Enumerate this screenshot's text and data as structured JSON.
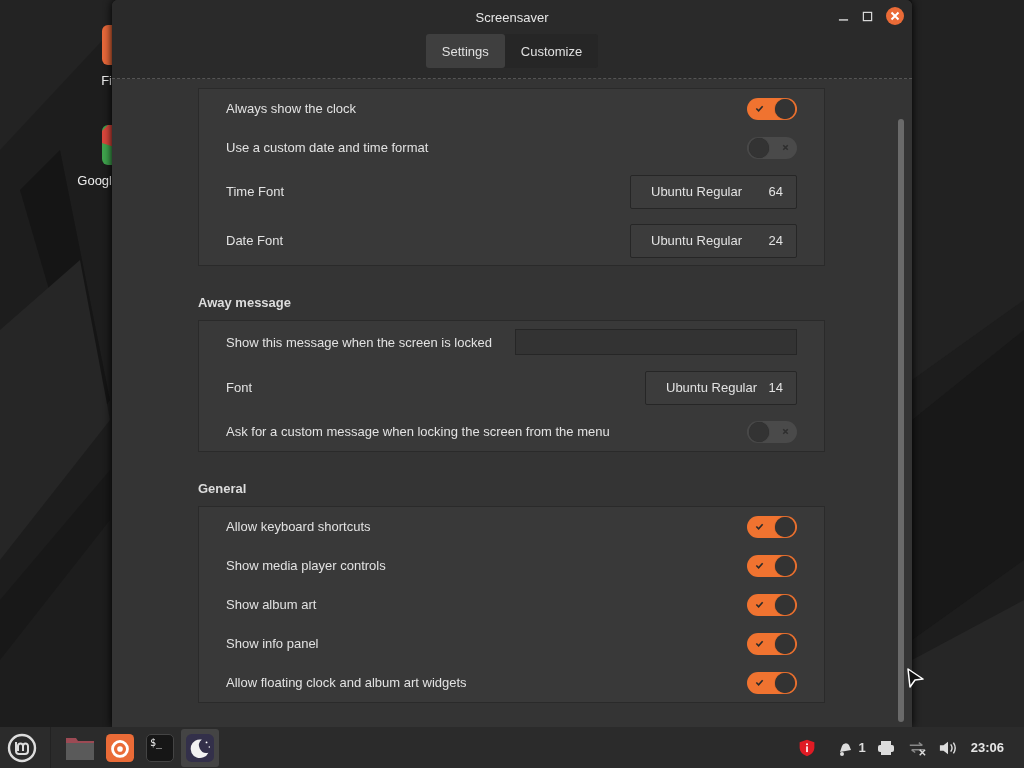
{
  "desktop_icons": [
    {
      "label": "Fi"
    },
    {
      "label": "Googl"
    }
  ],
  "window": {
    "title": "Screensaver",
    "tabs": [
      {
        "label": "Settings",
        "selected": true
      },
      {
        "label": "Customize",
        "selected": false
      }
    ],
    "sections": [
      {
        "rows": [
          {
            "kind": "toggle",
            "label": "Always show the clock",
            "on": true
          },
          {
            "kind": "toggle",
            "label": "Use a custom date and time format",
            "on": false
          },
          {
            "kind": "font",
            "label": "Time Font",
            "font": "Ubuntu Regular",
            "size": "64"
          },
          {
            "kind": "font",
            "label": "Date Font",
            "font": "Ubuntu Regular",
            "size": "24"
          }
        ]
      },
      {
        "heading": "Away message",
        "rows": [
          {
            "kind": "entry",
            "label": "Show this message when the screen is locked"
          },
          {
            "kind": "font",
            "label": "Font",
            "font": "Ubuntu Regular",
            "size": "14"
          },
          {
            "kind": "toggle",
            "label": "Ask for a custom message when locking the screen from the menu",
            "on": false
          }
        ]
      },
      {
        "heading": "General",
        "rows": [
          {
            "kind": "toggle",
            "label": "Allow keyboard shortcuts",
            "on": true
          },
          {
            "kind": "toggle",
            "label": "Show media player controls",
            "on": true
          },
          {
            "kind": "toggle",
            "label": "Show album art",
            "on": true
          },
          {
            "kind": "toggle",
            "label": "Show info panel",
            "on": true
          },
          {
            "kind": "toggle",
            "label": "Allow floating clock and album art widgets",
            "on": true
          }
        ]
      }
    ]
  },
  "taskbar": {
    "launchers": [
      {
        "kind": "folder",
        "selected": false
      },
      {
        "kind": "browser",
        "selected": false
      },
      {
        "kind": "terminal",
        "glyph": "$_",
        "selected": false
      },
      {
        "kind": "screensaver",
        "selected": true
      }
    ],
    "notification_count": "1",
    "clock": "23:06"
  }
}
